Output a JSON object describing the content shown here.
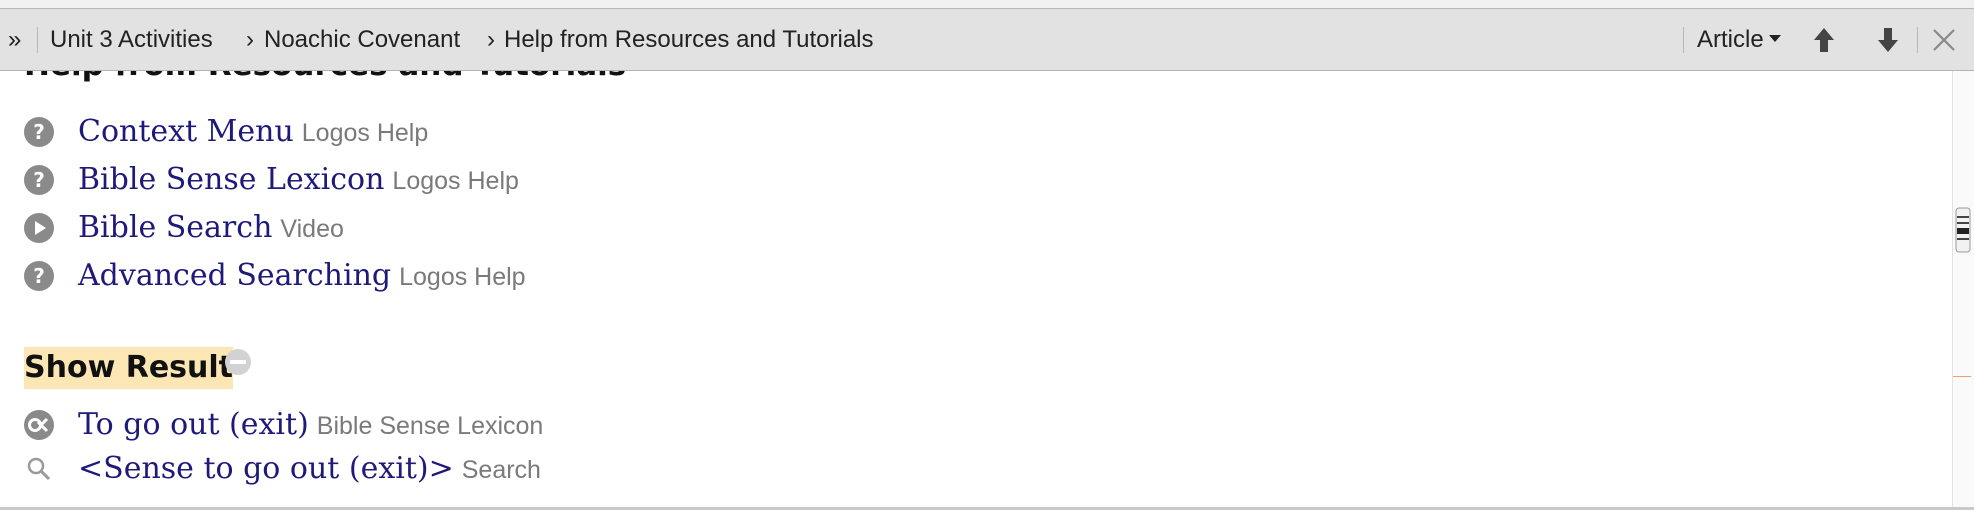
{
  "toolbar": {
    "overflow_glyph": "»",
    "breadcrumbs": [
      "Unit 3 Activities",
      "Noachic Covenant",
      "Help from Resources and Tutorials"
    ],
    "crumb_separator": "›",
    "article_label": "Article",
    "icons": [
      "up-arrow-icon",
      "down-arrow-icon",
      "close-icon"
    ]
  },
  "content": {
    "section_heading": "Help from Resources and Tutorials",
    "help_items": [
      {
        "title": "Context Menu",
        "source": "Logos Help",
        "icon": "help-icon"
      },
      {
        "title": "Bible Sense Lexicon",
        "source": "Logos Help",
        "icon": "help-icon"
      },
      {
        "title": "Bible Search",
        "source": "Video",
        "icon": "play-icon"
      },
      {
        "title": "Advanced Searching",
        "source": "Logos Help",
        "icon": "help-icon"
      }
    ],
    "show_result_label": "Show Result",
    "results": [
      {
        "title": "To go out (exit)",
        "source": "Bible Sense Lexicon",
        "icon": "bible-sense-icon"
      },
      {
        "title": "<Sense to go out (exit)>",
        "source": "Search",
        "icon": "search-icon"
      }
    ]
  },
  "colors": {
    "toolbar_bg": "#e2e2e2",
    "link": "#1d1a7a",
    "source_text": "#7a7a7a",
    "highlight": "#fbe6b4",
    "icon_gray": "#8a8a8a"
  }
}
